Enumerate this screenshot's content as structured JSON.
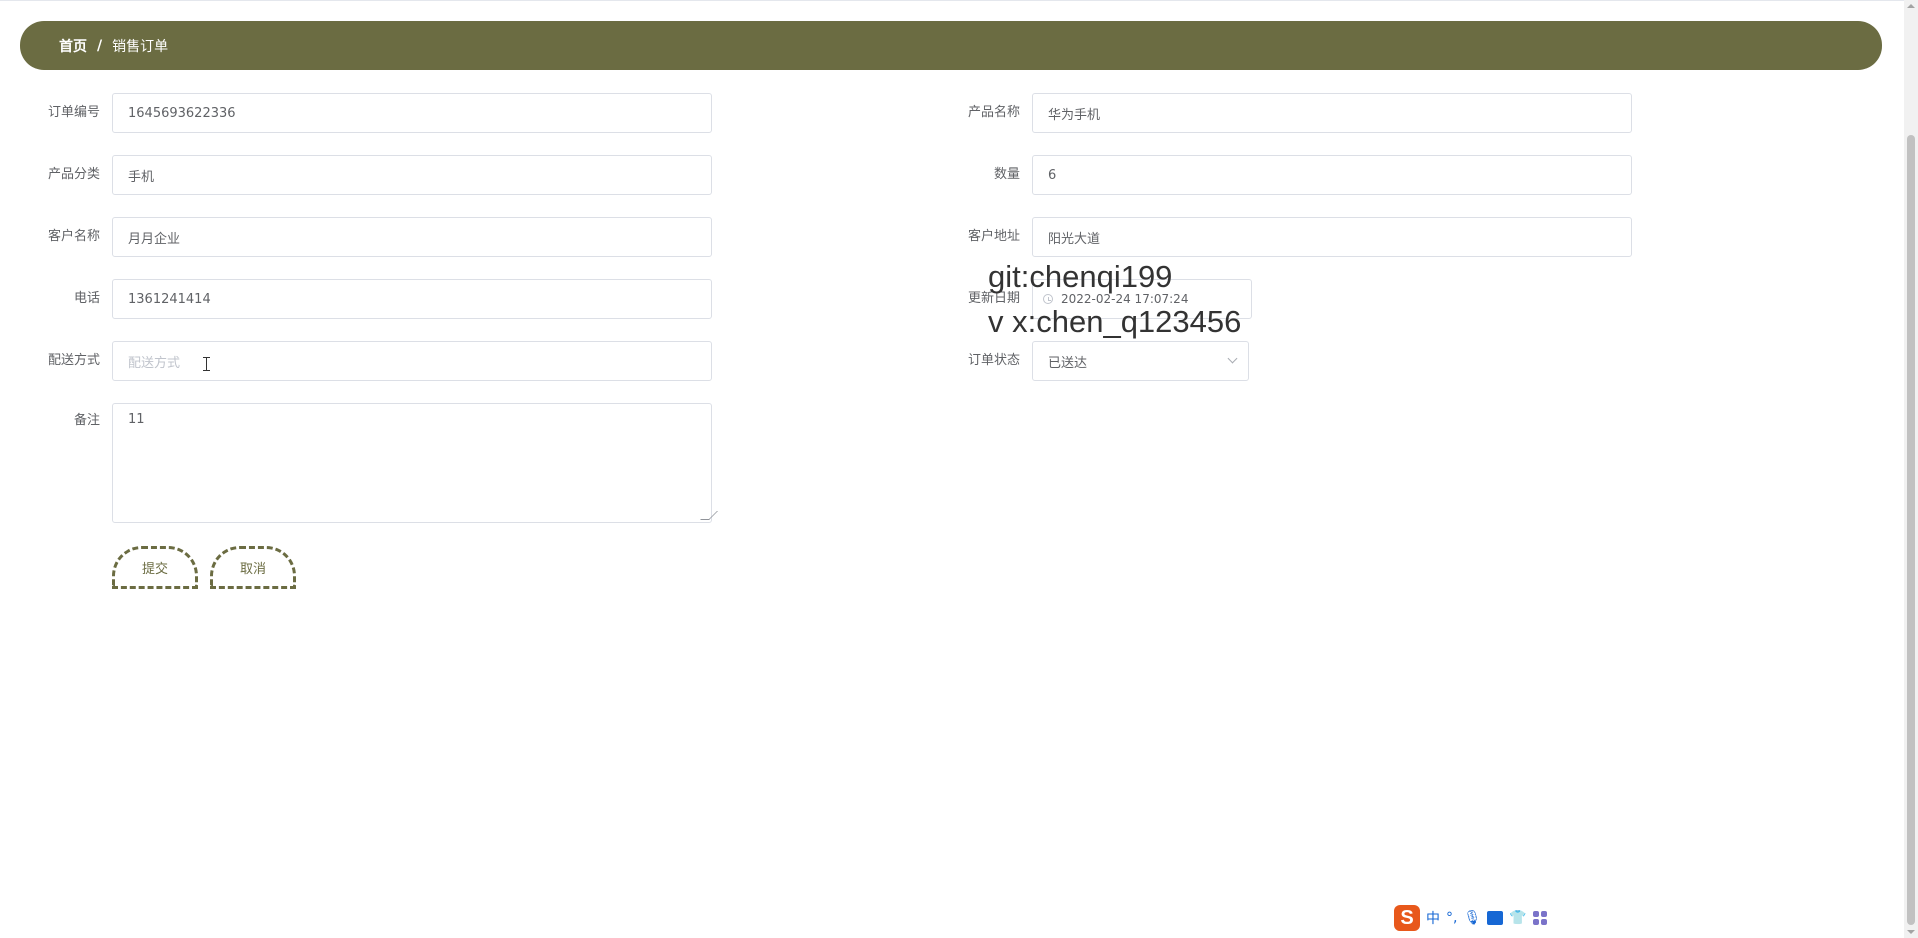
{
  "breadcrumb": {
    "home": "首页",
    "separator": "/",
    "current": "销售订单"
  },
  "form": {
    "order_no": {
      "label": "订单编号",
      "value": "1645693622336"
    },
    "product_name": {
      "label": "产品名称",
      "value": "华为手机"
    },
    "product_category": {
      "label": "产品分类",
      "value": "手机"
    },
    "quantity": {
      "label": "数量",
      "value": "6"
    },
    "customer_name": {
      "label": "客户名称",
      "value": "月月企业"
    },
    "customer_address": {
      "label": "客户地址",
      "value": "阳光大道"
    },
    "phone": {
      "label": "电话",
      "value": "1361241414"
    },
    "update_date": {
      "label": "更新日期",
      "value": "2022-02-24 17:07:24"
    },
    "delivery_method": {
      "label": "配送方式",
      "value": "",
      "placeholder": "配送方式"
    },
    "order_status": {
      "label": "订单状态",
      "value": "已送达"
    },
    "remark": {
      "label": "备注",
      "value": "11"
    }
  },
  "buttons": {
    "submit": "提交",
    "cancel": "取消"
  },
  "watermark": {
    "line1": "git:chenqi199",
    "line2": "v x:chen_q123456"
  },
  "ime": {
    "lang": "中",
    "punct": "°,"
  }
}
